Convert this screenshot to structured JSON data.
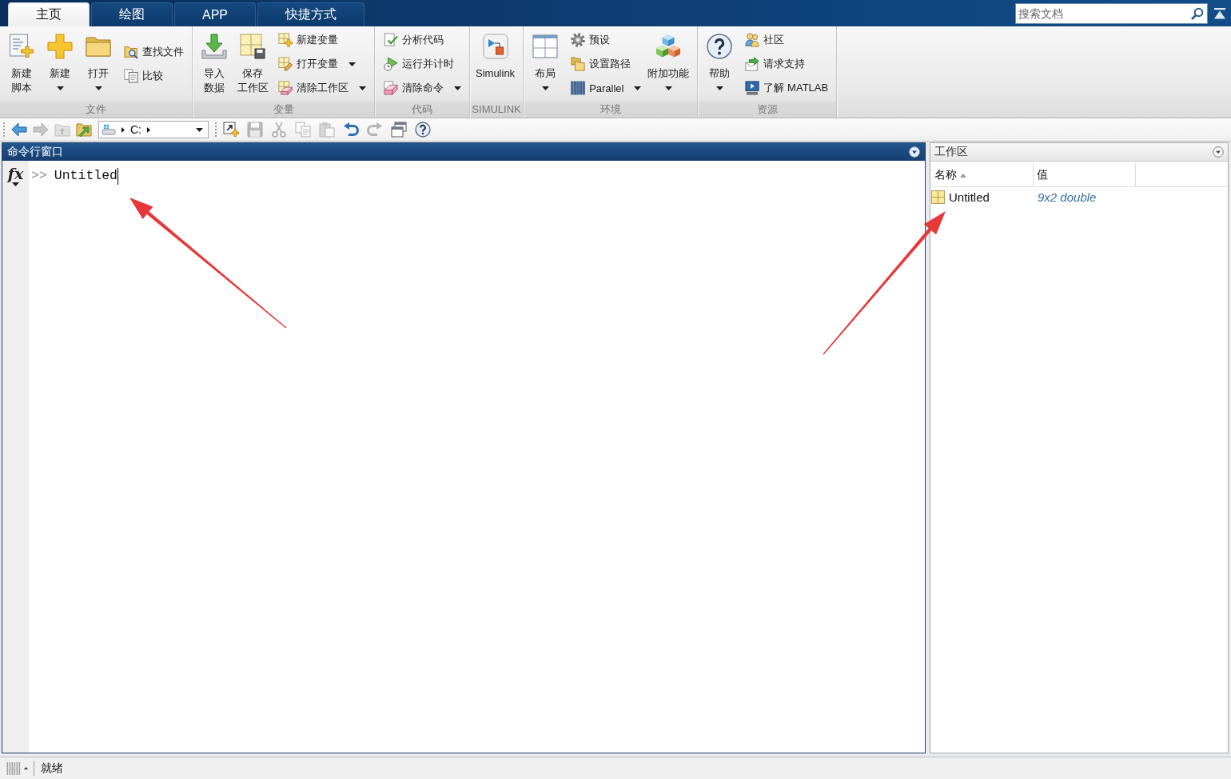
{
  "tabs": [
    {
      "label": "主页",
      "selected": true
    },
    {
      "label": "绘图",
      "selected": false
    },
    {
      "label": "APP",
      "selected": false
    },
    {
      "label": "快捷方式",
      "selected": false
    }
  ],
  "search": {
    "placeholder": "搜索文档"
  },
  "ribbon": {
    "groups": [
      {
        "label": "文件",
        "columns": [
          {
            "kind": "large",
            "label": "新建脚本",
            "dropdown": false
          },
          {
            "kind": "large",
            "label": "新建",
            "dropdown": true
          },
          {
            "kind": "large",
            "label": "打开",
            "dropdown": true
          },
          {
            "kind": "stack",
            "items": [
              {
                "label": "查找文件",
                "dropdown": false
              },
              {
                "label": "比较",
                "dropdown": false
              }
            ]
          }
        ]
      },
      {
        "label": "变量",
        "columns": [
          {
            "kind": "large",
            "label": "导入数据",
            "dropdown": false
          },
          {
            "kind": "large",
            "label": "保存工作区",
            "dropdown": false
          },
          {
            "kind": "stack",
            "items": [
              {
                "label": "新建变量",
                "dropdown": false
              },
              {
                "label": "打开变量",
                "dropdown": true
              },
              {
                "label": "清除工作区",
                "dropdown": true
              }
            ]
          }
        ]
      },
      {
        "label": "代码",
        "columns": [
          {
            "kind": "stack",
            "items": [
              {
                "label": "分析代码",
                "dropdown": false
              },
              {
                "label": "运行并计时",
                "dropdown": false
              },
              {
                "label": "清除命令",
                "dropdown": true
              }
            ]
          }
        ]
      },
      {
        "label": "SIMULINK",
        "columns": [
          {
            "kind": "large",
            "label": "Simulink",
            "dropdown": false
          }
        ]
      },
      {
        "label": "环境",
        "columns": [
          {
            "kind": "large",
            "label": "布局",
            "dropdown": true
          },
          {
            "kind": "stack",
            "items": [
              {
                "label": "预设",
                "dropdown": false
              },
              {
                "label": "设置路径",
                "dropdown": false
              },
              {
                "label": "Parallel",
                "dropdown": true
              }
            ]
          },
          {
            "kind": "large",
            "label": "附加功能",
            "dropdown": true
          }
        ]
      },
      {
        "label": "资源",
        "columns": [
          {
            "kind": "large",
            "label": "帮助",
            "dropdown": true
          },
          {
            "kind": "stack",
            "items": [
              {
                "label": "社区",
                "dropdown": false
              },
              {
                "label": "请求支持",
                "dropdown": false
              },
              {
                "label": "了解 MATLAB",
                "dropdown": false
              }
            ]
          }
        ]
      }
    ]
  },
  "toolbar": {
    "nav_buttons": [
      {
        "disabled": false
      },
      {
        "disabled": true
      },
      {
        "disabled": true
      },
      {
        "disabled": false
      }
    ],
    "path": {
      "segments": [
        "C:"
      ]
    },
    "tool_buttons": [
      {
        "disabled": false
      },
      {
        "disabled": true
      },
      {
        "disabled": true
      },
      {
        "disabled": true
      },
      {
        "disabled": true
      },
      {
        "disabled": false
      },
      {
        "disabled": true
      },
      {
        "disabled": false
      },
      {
        "disabled": false
      }
    ]
  },
  "command_window": {
    "title": "命令行窗口",
    "function_button": "fx",
    "prompt": ">>",
    "input": "Untitled"
  },
  "workspace": {
    "title": "工作区",
    "columns": [
      {
        "label": "名称",
        "sorted": true
      },
      {
        "label": "值",
        "sorted": false
      }
    ],
    "rows": [
      {
        "name": "Untitled",
        "value": "9x2 double"
      }
    ]
  },
  "status_bar": {
    "text": "就绪"
  }
}
